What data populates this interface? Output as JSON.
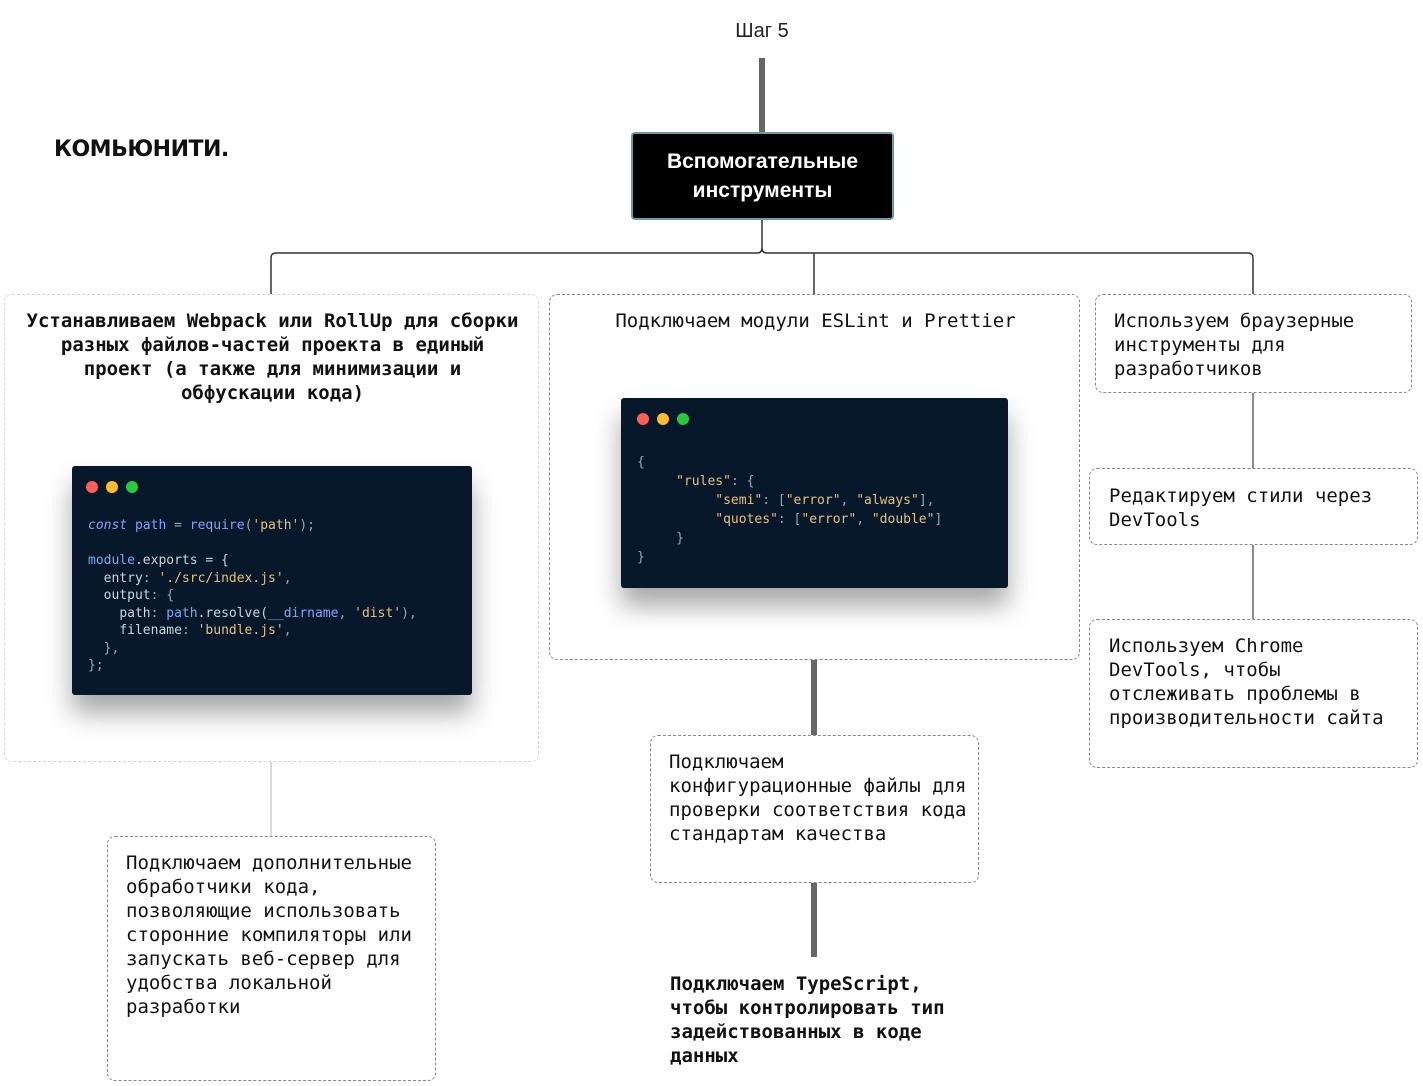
{
  "step_label": "Шаг 5",
  "brand": "КОМЬЮНИТИ.",
  "root": {
    "title": "Вспомогательные инструменты"
  },
  "left": {
    "title": "Устанавливаем Webpack или RollUp для сборки разных файлов-частей проекта в единый проект (а также для минимизации и обфускации кода)",
    "code": {
      "line1_kw": "const",
      "line1_var": "path",
      "line1_eq": "=",
      "line1_fn": "require",
      "line1_arg": "'path'",
      "line1_end": ");",
      "module": "module",
      "exports": ".exports = {",
      "entry_key": "entry",
      "entry_val": "'./src/index.js'",
      "output_key": "output",
      "path_key": "path",
      "path_obj": "path",
      "resolve": ".resolve(",
      "dirname": "__dirname",
      "dist": "'dist'",
      "filename_key": "filename",
      "filename_val": "'bundle.js'",
      "close_inner": "},",
      "close_outer": "};"
    },
    "child": "Подключаем дополнительные обработчики кода, позволяющие использовать сторонние компиляторы или запускать веб-сервер для удобства локальной разработки"
  },
  "middle": {
    "title": "Подключаем модули ESLint и Prettier",
    "code": {
      "open": "{",
      "rules_key": "\"rules\"",
      "semi_key": "\"semi\"",
      "semi_v1": "\"error\"",
      "semi_v2": "\"always\"",
      "quotes_key": "\"quotes\"",
      "quotes_v1": "\"error\"",
      "quotes_v2": "\"double\"",
      "close_inner": "}",
      "close_outer": "}"
    },
    "child1": "Подключаем конфигурационные файлы для проверки соответствия кода стандартам качества",
    "child2": "Подключаем TypeScript, чтобы контролировать тип задействованных в коде данных"
  },
  "right": {
    "item1": "Используем браузерные инструменты для разработчиков",
    "item2": "Редактируем стили через DevTools",
    "item3": "Используем Chrome DevTools, чтобы отслеживать проблемы в производительности сайта"
  },
  "colors": {
    "root_bg": "#000000",
    "root_border": "#6e9aa6",
    "editor_bg": "#07182a",
    "connector": "#666666"
  }
}
